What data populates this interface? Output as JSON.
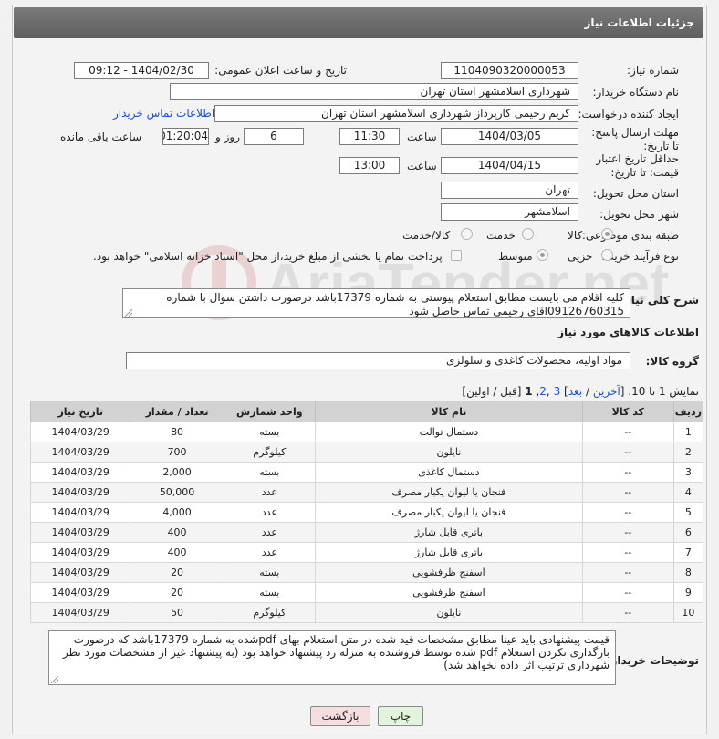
{
  "page": {
    "title": "جزئیات اطلاعات نیاز"
  },
  "form": {
    "need_number_label": "شماره نیاز:",
    "need_number": "1104090320000053",
    "announce_label": "تاریخ و ساعت اعلان عمومی:",
    "announce_value": "1404/02/30 - 09:12",
    "buyer_org_label": "نام دستگاه خریدار:",
    "buyer_org": "شهرداری اسلامشهر استان تهران",
    "creator_label": "ایجاد کننده درخواست:",
    "creator": "کریم رحیمی کارپرداز شهرداری اسلامشهر استان تهران",
    "contact_link": "اطلاعات تماس خریدار",
    "deadline_label": "مهلت ارسال پاسخ: تا تاریخ:",
    "deadline_date": "1404/03/05",
    "time_label": "ساعت",
    "deadline_time": "11:30",
    "days_value": "6",
    "days_label": "روز و",
    "remaining_time": "01:20:04",
    "remaining_label": "ساعت باقی مانده",
    "validity_label": "حداقل تاریخ اعتبار قیمت: تا تاریخ:",
    "validity_date": "1404/04/15",
    "validity_time": "13:00",
    "province_label": "استان محل تحویل:",
    "province": "تهران",
    "city_label": "شهر محل تحویل:",
    "city": "اسلامشهر",
    "category_label": "طبقه بندی موضوعی:",
    "category_options": [
      "کالا",
      "خدمت",
      "کالا/خدمت"
    ],
    "category_selected": "کالا",
    "process_label": "نوع فرآیند خرید :",
    "process_options": [
      "جزیی",
      "متوسط"
    ],
    "process_selected": "متوسط",
    "payment_note": "پرداخت تمام یا بخشی از مبلغ خرید،از محل \"اسناد خزانه اسلامی\" خواهد بود."
  },
  "description": {
    "label": "شرح کلی نیاز:",
    "text": "کلیه اقلام می بایست مطابق استعلام پیوستی به شماره 17379باشد درصورت داشتن سوال با شماره 09126760315اقای رحیمی تماس حاصل شود"
  },
  "goods": {
    "section_title": "اطلاعات کالاهای مورد نیاز",
    "group_label": "گروه کالا:",
    "group_value": "مواد اولیه، محصولات کاغذی و سلولزی"
  },
  "pagination": {
    "showing": "نمایش 1 تا 10.",
    "open": "[",
    "last": "آخرین",
    "sep1": "/",
    "next": "بعد",
    "close": "]",
    "page3": "3",
    "comma1": ",",
    "page2": "2",
    "comma2": ",",
    "page1": "1",
    "rest": "[قبل / اولین]"
  },
  "table": {
    "headers": [
      "ردیف",
      "کد کالا",
      "نام کالا",
      "واحد شمارش",
      "تعداد / مقدار",
      "تاریخ نیاز"
    ],
    "rows": [
      [
        "1",
        "--",
        "دستمال توالت",
        "بسته",
        "80",
        "1404/03/29"
      ],
      [
        "2",
        "--",
        "نایلون",
        "کیلوگرم",
        "700",
        "1404/03/29"
      ],
      [
        "3",
        "--",
        "دستمال کاغذی",
        "بسته",
        "2,000",
        "1404/03/29"
      ],
      [
        "4",
        "--",
        "فنجان یا لیوان یکبار مصرف",
        "عدد",
        "50,000",
        "1404/03/29"
      ],
      [
        "5",
        "--",
        "فنجان یا لیوان یکبار مصرف",
        "عدد",
        "4,000",
        "1404/03/29"
      ],
      [
        "6",
        "--",
        "باتری قابل شارژ",
        "عدد",
        "400",
        "1404/03/29"
      ],
      [
        "7",
        "--",
        "باتری قابل شارژ",
        "عدد",
        "400",
        "1404/03/29"
      ],
      [
        "8",
        "--",
        "اسفنج ظرفشویی",
        "بسته",
        "20",
        "1404/03/29"
      ],
      [
        "9",
        "--",
        "اسفنج ظرفشویی",
        "بسته",
        "20",
        "1404/03/29"
      ],
      [
        "10",
        "--",
        "نایلون",
        "کیلوگرم",
        "50",
        "1404/03/29"
      ]
    ]
  },
  "buyer_notes": {
    "label": "توضیحات خریدار:",
    "text": "قیمت پیشنهادی باید عینا مطابق مشخصات قید شده در متن استعلام بهای pdfشده به شماره 17379باشد که درصورت بارگذاری نکردن استعلام pdf شده توسط فروشنده به منزله رد پیشنهاد خواهد بود (به پیشنهاد غیر از مشخصات مورد نظر شهرداری ترتیب اثر داده نخواهد  شد)"
  },
  "buttons": {
    "print": "چاپ",
    "back": "بازگشت"
  },
  "watermark": {
    "text": "AriaTender.net"
  }
}
